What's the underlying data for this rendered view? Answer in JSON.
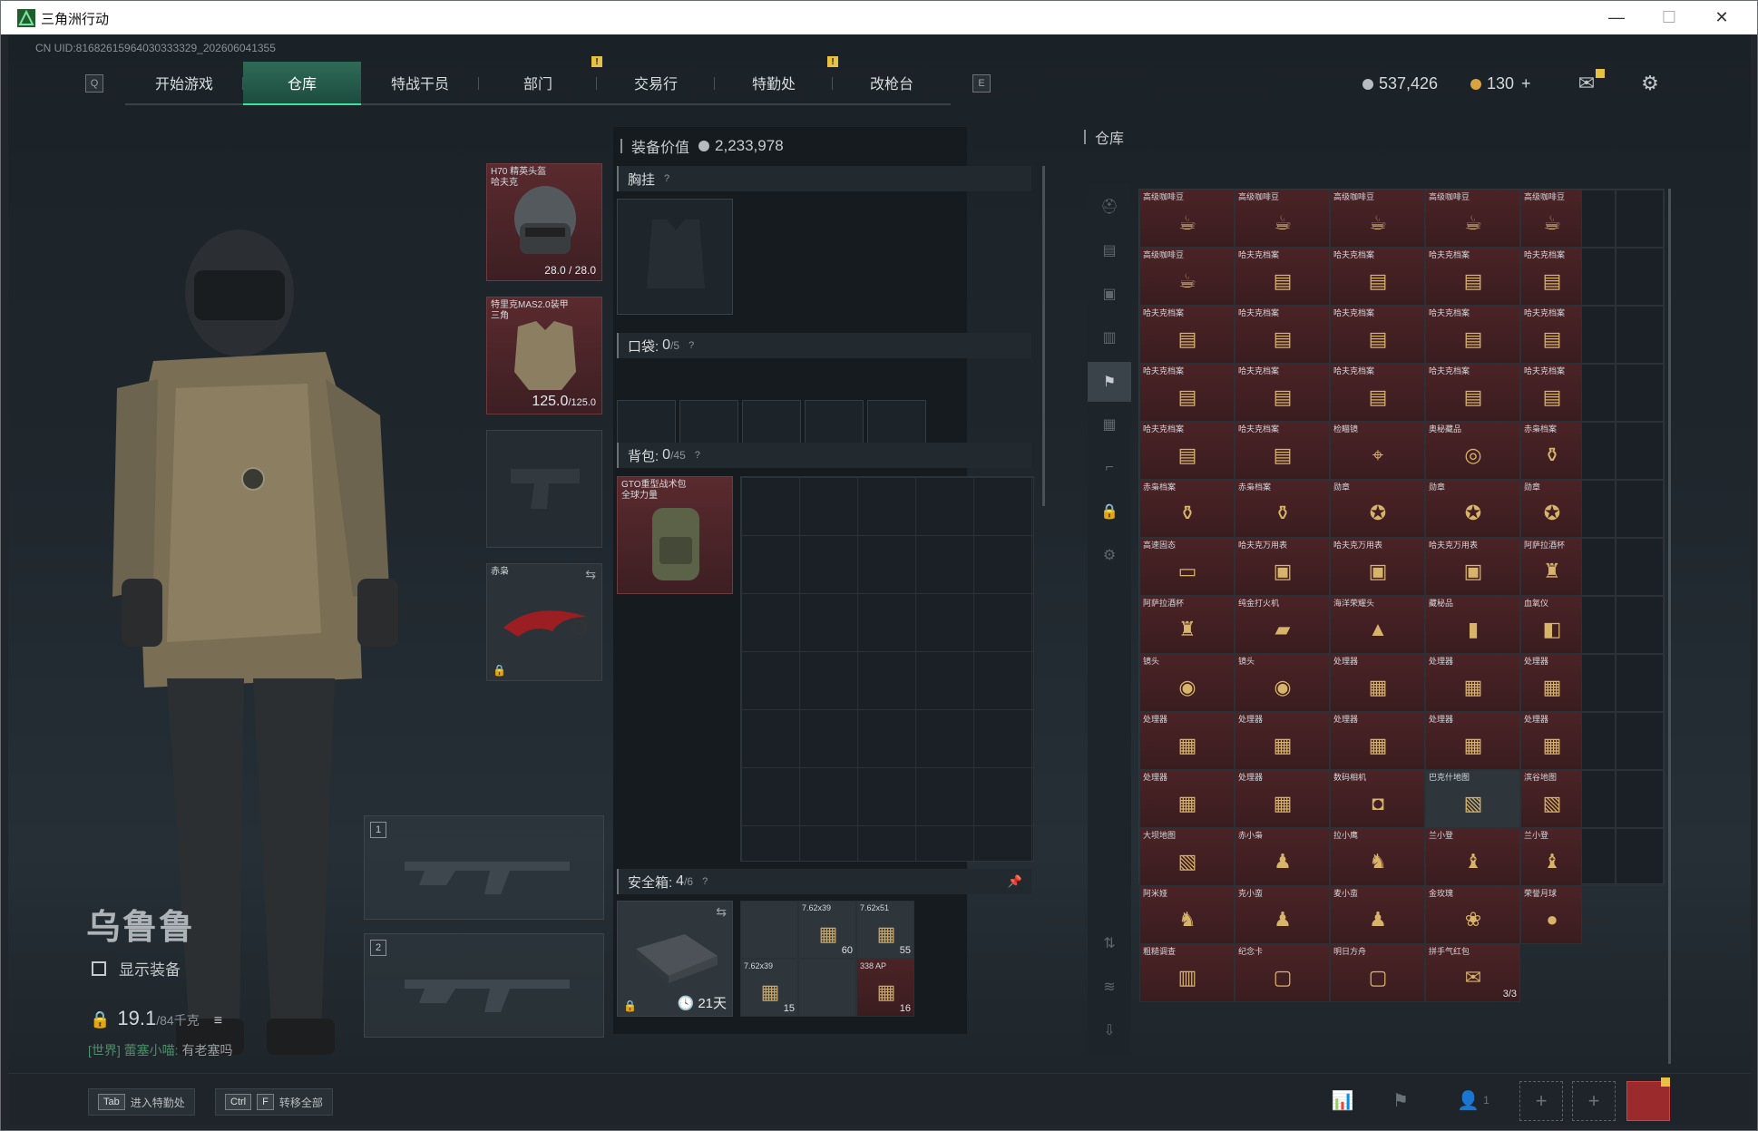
{
  "window": {
    "title": "三角洲行动",
    "min": "—",
    "max": "☐",
    "close": "✕"
  },
  "uid": "CN UID:81682615964030333329_202606041355",
  "nav": {
    "left_key": "Q",
    "right_key": "E",
    "tabs": [
      {
        "label": "开始游戏",
        "badge": ""
      },
      {
        "label": "仓库",
        "badge": ""
      },
      {
        "label": "特战干员",
        "badge": ""
      },
      {
        "label": "部门",
        "badge": "!"
      },
      {
        "label": "交易行",
        "badge": ""
      },
      {
        "label": "特勤处",
        "badge": "!"
      },
      {
        "label": "改枪台",
        "badge": ""
      }
    ]
  },
  "currency": {
    "money": "537,426",
    "coupons": "130",
    "plus": "+"
  },
  "colors": {
    "accent": "#3ee39b",
    "tab_active": "#2e6b57",
    "item_red": "#4b2326",
    "badge": "#e8c140"
  },
  "operator": {
    "name": "乌鲁鲁",
    "show_equipment": "显示装备",
    "weight": "19.1",
    "weight_cap": "/84千克"
  },
  "chat": {
    "channel": "[世界]",
    "user": "蕾塞小喵:",
    "message": "有老塞吗"
  },
  "equipment": {
    "helmet": {
      "label": "H70 精英头盔\n哈夫克",
      "durability": "28.0 / 28.0"
    },
    "armor": {
      "label": "特里克MAS2.0装甲\n三角",
      "durability": "125.0",
      "durability_max": "/125.0"
    },
    "melee": {
      "label": "赤枭"
    },
    "weapon1": "1",
    "weapon2": "2"
  },
  "loadout": {
    "value_label": "装备价值",
    "value": "2,233,978",
    "chest": {
      "label": "胸挂",
      "q": "?"
    },
    "pocket": {
      "label": "口袋:",
      "count": "0",
      "max": "/5",
      "q": "?"
    },
    "backpack": {
      "label": "背包:",
      "count": "0",
      "max": "/45",
      "q": "?",
      "item_label": "GTO重型战术包\n全球力量"
    },
    "safebox": {
      "label": "安全箱:",
      "count": "4",
      "max": "/6",
      "q": "?",
      "timer": "21天",
      "items": [
        {
          "label": "7.62x39",
          "count": "60"
        },
        {
          "label": "7.62x51",
          "count": "55"
        },
        {
          "label": "7.62x39",
          "count": "15"
        },
        {
          "label": "338 AP",
          "count": "16"
        }
      ]
    }
  },
  "stash": {
    "title": "仓库",
    "items": [
      {
        "label": "高级咖啡豆",
        "icon": "☕",
        "bg": "red"
      },
      {
        "label": "高级咖啡豆",
        "icon": "☕",
        "bg": "red"
      },
      {
        "label": "高级咖啡豆",
        "icon": "☕",
        "bg": "red"
      },
      {
        "label": "高级咖啡豆",
        "icon": "☕",
        "bg": "red"
      },
      {
        "label": "高级咖啡豆",
        "icon": "☕",
        "bg": "red"
      },
      {
        "label": "高级咖啡豆",
        "icon": "☕",
        "bg": "red"
      },
      {
        "label": "哈夫克档案",
        "icon": "▤",
        "bg": "red"
      },
      {
        "label": "哈夫克档案",
        "icon": "▤",
        "bg": "red"
      },
      {
        "label": "哈夫克档案",
        "icon": "▤",
        "bg": "red"
      },
      {
        "label": "哈夫克档案",
        "icon": "▤",
        "bg": "red"
      },
      {
        "label": "哈夫克档案",
        "icon": "▤",
        "bg": "red"
      },
      {
        "label": "哈夫克档案",
        "icon": "▤",
        "bg": "red"
      },
      {
        "label": "哈夫克档案",
        "icon": "▤",
        "bg": "red"
      },
      {
        "label": "哈夫克档案",
        "icon": "▤",
        "bg": "red"
      },
      {
        "label": "哈夫克档案",
        "icon": "▤",
        "bg": "red"
      },
      {
        "label": "哈夫克档案",
        "icon": "▤",
        "bg": "red"
      },
      {
        "label": "哈夫克档案",
        "icon": "▤",
        "bg": "red"
      },
      {
        "label": "哈夫克档案",
        "icon": "▤",
        "bg": "red"
      },
      {
        "label": "哈夫克档案",
        "icon": "▤",
        "bg": "red"
      },
      {
        "label": "哈夫克档案",
        "icon": "▤",
        "bg": "red"
      },
      {
        "label": "哈夫克档案",
        "icon": "▤",
        "bg": "red"
      },
      {
        "label": "哈夫克档案",
        "icon": "▤",
        "bg": "red"
      },
      {
        "label": "检瞄镜",
        "icon": "⌖",
        "bg": "red"
      },
      {
        "label": "奥秘藏品",
        "icon": "◎",
        "bg": "red"
      },
      {
        "label": "赤枭档案",
        "icon": "⚱",
        "bg": "red"
      },
      {
        "label": "赤枭档案",
        "icon": "⚱",
        "bg": "red"
      },
      {
        "label": "赤枭档案",
        "icon": "⚱",
        "bg": "red"
      },
      {
        "label": "勋章",
        "icon": "✪",
        "bg": "red"
      },
      {
        "label": "勋章",
        "icon": "✪",
        "bg": "red"
      },
      {
        "label": "勋章",
        "icon": "✪",
        "bg": "red"
      },
      {
        "label": "高速固态",
        "icon": "▭",
        "bg": "red"
      },
      {
        "label": "哈夫克万用表",
        "icon": "▣",
        "bg": "red"
      },
      {
        "label": "哈夫克万用表",
        "icon": "▣",
        "bg": "red"
      },
      {
        "label": "哈夫克万用表",
        "icon": "▣",
        "bg": "red"
      },
      {
        "label": "阿萨拉酒杯",
        "icon": "♜",
        "bg": "red"
      },
      {
        "label": "阿萨拉酒杯",
        "icon": "♜",
        "bg": "red"
      },
      {
        "label": "纯金打火机",
        "icon": "▰",
        "bg": "red"
      },
      {
        "label": "海洋荣耀头",
        "icon": "▲",
        "bg": "red"
      },
      {
        "label": "藏秘品",
        "icon": "▮",
        "bg": "red"
      },
      {
        "label": "血氧仪",
        "icon": "◧",
        "bg": "red"
      },
      {
        "label": "镜头",
        "icon": "◉",
        "bg": "red"
      },
      {
        "label": "镜头",
        "icon": "◉",
        "bg": "red"
      },
      {
        "label": "处理器",
        "icon": "▦",
        "bg": "red"
      },
      {
        "label": "处理器",
        "icon": "▦",
        "bg": "red"
      },
      {
        "label": "处理器",
        "icon": "▦",
        "bg": "red"
      },
      {
        "label": "处理器",
        "icon": "▦",
        "bg": "red"
      },
      {
        "label": "处理器",
        "icon": "▦",
        "bg": "red"
      },
      {
        "label": "处理器",
        "icon": "▦",
        "bg": "red"
      },
      {
        "label": "处理器",
        "icon": "▦",
        "bg": "red"
      },
      {
        "label": "处理器",
        "icon": "▦",
        "bg": "red"
      },
      {
        "label": "处理器",
        "icon": "▦",
        "bg": "red"
      },
      {
        "label": "处理器",
        "icon": "▦",
        "bg": "red"
      },
      {
        "label": "数码相机",
        "icon": "◘",
        "bg": "red"
      },
      {
        "label": "巴克什地图",
        "icon": "▧",
        "bg": "gray"
      },
      {
        "label": "滨谷地图",
        "icon": "▧",
        "bg": "red"
      },
      {
        "label": "大坝地图",
        "icon": "▧",
        "bg": "red"
      },
      {
        "label": "赤小枭",
        "icon": "♟",
        "bg": "red"
      },
      {
        "label": "拉小鹰",
        "icon": "♞",
        "bg": "red"
      },
      {
        "label": "兰小登",
        "icon": "♝",
        "bg": "red"
      },
      {
        "label": "兰小登",
        "icon": "♝",
        "bg": "red"
      },
      {
        "label": "阿米娅",
        "icon": "♞",
        "bg": "red"
      },
      {
        "label": "克小蛮",
        "icon": "♟",
        "bg": "red"
      },
      {
        "label": "麦小蛮",
        "icon": "♟",
        "bg": "red"
      },
      {
        "label": "金玫瑰",
        "icon": "❀",
        "bg": "red"
      },
      {
        "label": "荣誉月球",
        "icon": "●",
        "bg": "red"
      },
      {
        "label": "粗糙调查",
        "icon": "▥",
        "bg": "red"
      },
      {
        "label": "纪念卡",
        "icon": "▢",
        "bg": "red"
      },
      {
        "label": "明日方舟",
        "icon": "▢",
        "bg": "red"
      },
      {
        "label": "拼手气红包",
        "icon": "✉",
        "bg": "red",
        "count": "3/3"
      }
    ]
  },
  "bottom": {
    "hint1_key": "Tab",
    "hint1_text": "进入特勤处",
    "hint2_key1": "Ctrl",
    "hint2_key2": "F",
    "hint2_text": "转移全部",
    "squad_count": "1"
  }
}
